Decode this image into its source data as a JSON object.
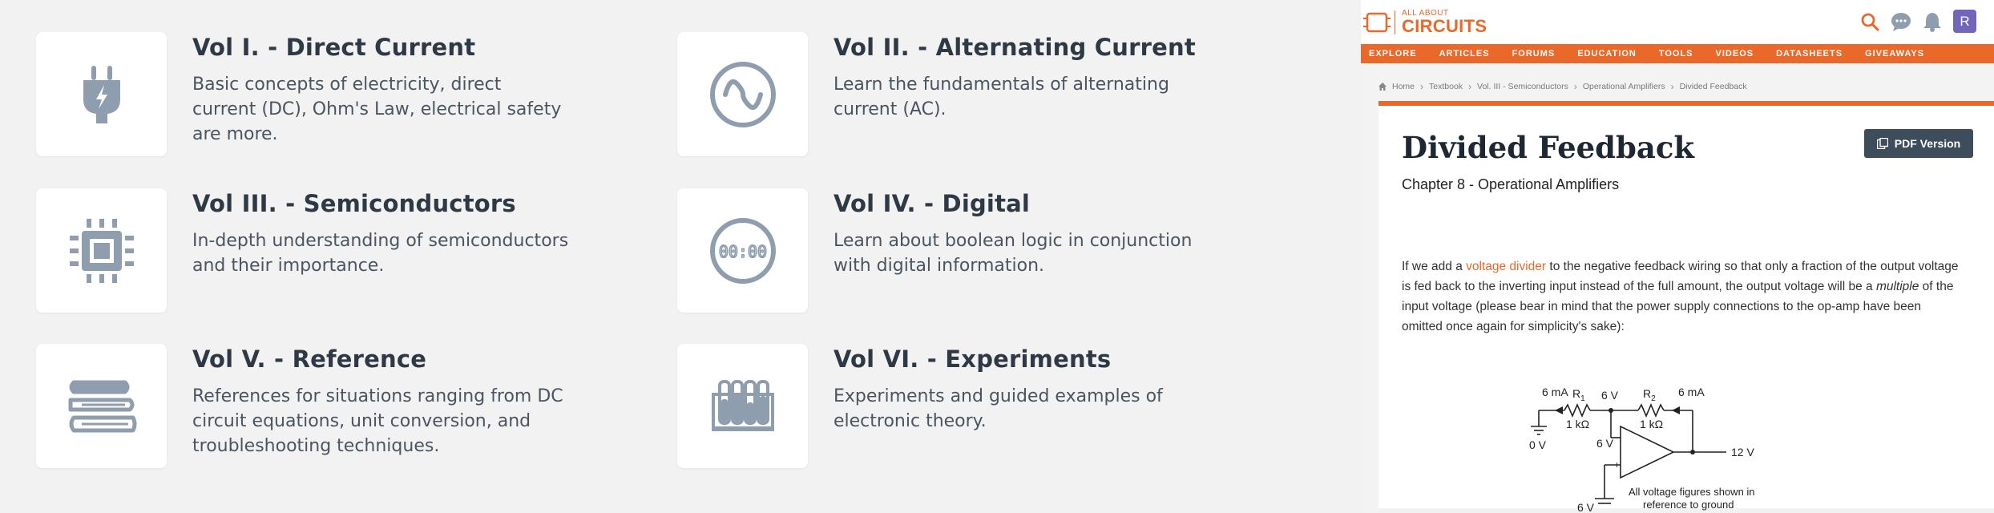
{
  "volumes": [
    {
      "title": "Vol I. - Direct Current",
      "desc": "Basic concepts of electricity, direct current (DC), Ohm's Law, electrical safety are more.",
      "icon": "plug-icon"
    },
    {
      "title": "Vol II. - Alternating Current",
      "desc": "Learn the fundamentals of alternating current (AC).",
      "icon": "sine-wave-icon"
    },
    {
      "title": "Vol III. - Semiconductors",
      "desc": "In-depth understanding of semiconductors and their importance.",
      "icon": "chip-icon"
    },
    {
      "title": "Vol IV. - Digital",
      "desc": "Learn about boolean logic in conjunction with digital information.",
      "icon": "digital-clock-icon"
    },
    {
      "title": "Vol V. - Reference",
      "desc": "References for situations ranging from DC circuit equations, unit conversion, and troubleshooting techniques.",
      "icon": "books-icon"
    },
    {
      "title": "Vol VI. - Experiments",
      "desc": "Experiments and guided examples of electronic theory.",
      "icon": "test-tubes-icon"
    }
  ],
  "site": {
    "logo_small": "ALL ABOUT",
    "logo_big": "CIRCUITS",
    "avatar_letter": "R",
    "nav": [
      "EXPLORE",
      "ARTICLES",
      "FORUMS",
      "EDUCATION",
      "TOOLS",
      "VIDEOS",
      "DATASHEETS",
      "GIVEAWAYS"
    ],
    "breadcrumb": [
      "Home",
      "Textbook",
      "Vol. III - Semiconductors",
      "Operational Amplifiers",
      "Divided Feedback"
    ]
  },
  "article": {
    "title": "Divided Feedback",
    "pdf_label": "PDF Version",
    "chapter": "Chapter 8 - Operational Amplifiers",
    "para_before": "If we add a ",
    "para_link": "voltage divider",
    "para_mid": " to the negative feedback wiring so that only a fraction of the output voltage is fed back to the inverting input instead of the full amount, the output voltage will be a ",
    "para_em": "multiple",
    "para_after": " of the input voltage (please bear in mind that the power supply connections to the op-amp have been omitted once again for simplicity's sake):"
  },
  "schematic": {
    "i1": "6 mA",
    "r1": "R",
    "r1_sub": "1",
    "r1_val": "1 kΩ",
    "v_mid": "6 V",
    "r2": "R",
    "r2_sub": "2",
    "r2_val": "1 kΩ",
    "i2": "6 mA",
    "v_left": "6 V",
    "v_ground": "0 V",
    "v_out": "12 V",
    "v_in": "6 V",
    "note_line1": "All voltage figures shown in",
    "note_line2": "reference to ground"
  },
  "colors": {
    "accent": "#e8692a",
    "icon_gray": "#8f9eae",
    "dark": "#2f3946"
  }
}
